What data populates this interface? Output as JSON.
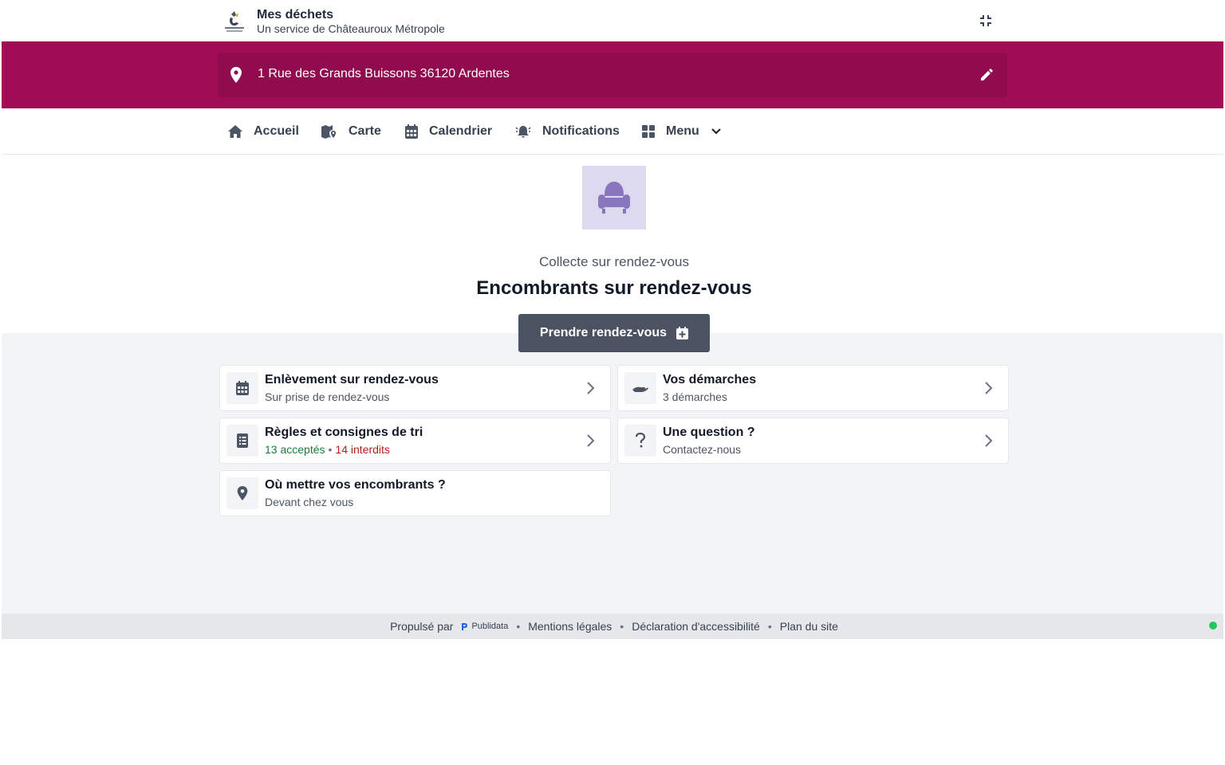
{
  "header": {
    "app_title": "Mes déchets",
    "app_subtitle": "Un service de Châteauroux Métropole",
    "logo_icon": "chateauroux-metropole-logo",
    "collapse_icon": "collapse-icon"
  },
  "address": {
    "text": "1 Rue des Grands Buissons 36120 Ardentes",
    "pin_icon": "map-pin-icon",
    "edit_icon": "pencil-icon"
  },
  "nav": {
    "items": [
      {
        "label": "Accueil",
        "icon": "home-icon"
      },
      {
        "label": "Carte",
        "icon": "map-marker-icon"
      },
      {
        "label": "Calendrier",
        "icon": "calendar-icon"
      },
      {
        "label": "Notifications",
        "icon": "bell-icon"
      },
      {
        "label": "Menu",
        "icon": "grid-icon"
      }
    ]
  },
  "hero": {
    "icon": "armchair-icon",
    "subtitle": "Collecte sur rendez-vous",
    "title": "Encombrants sur rendez-vous",
    "button_label": "Prendre rendez-vous"
  },
  "cards": [
    {
      "title": "Enlèvement sur rendez-vous",
      "subtitle": "Sur prise de rendez-vous",
      "icon": "calendar-icon"
    },
    {
      "title": "Vos démarches",
      "subtitle": "3 démarches",
      "icon": "hand-icon"
    },
    {
      "title": "Règles et consignes de tri",
      "accepted": "13 acceptés",
      "separator": "•",
      "forbidden": "14 interdits",
      "icon": "checklist-icon"
    },
    {
      "title": "Une question ?",
      "subtitle": "Contactez-nous",
      "icon": "question-icon"
    },
    {
      "title": "Où mettre vos encombrants ?",
      "subtitle": "Devant chez vous",
      "icon": "map-pin-icon"
    }
  ],
  "footer": {
    "powered_by": "Propulsé par",
    "brand": "Publidata",
    "sep": "•",
    "links": [
      "Mentions légales",
      "Déclaration d'accessibilité",
      "Plan du site"
    ]
  },
  "colors": {
    "brand": "#a00d57",
    "brand_dark": "#910c4f",
    "button": "#4b5261",
    "hero_icon_bg": "#ddd9ee",
    "hero_icon": "#8a76bf",
    "accepted": "#15803d",
    "forbidden": "#b91c1c",
    "status": "#22c55e"
  }
}
